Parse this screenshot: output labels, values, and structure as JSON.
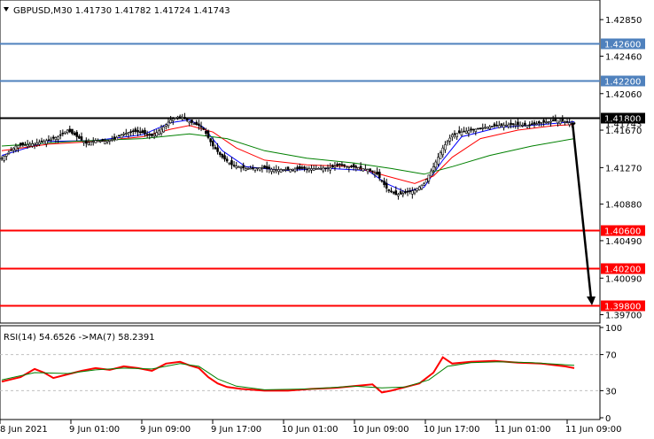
{
  "colors": {
    "background": "#ffffff",
    "candle": "#000000",
    "ma_blue": "#0000ff",
    "ma_red": "#ff0000",
    "ma_green": "#008000",
    "level_blue": "#4f81bd",
    "level_red": "#ff0000",
    "level_black": "#000000",
    "rsi_line": "#ff0000",
    "rsi_ma": "#008000"
  },
  "main_header": {
    "arrow_icon": "triangle-down-icon",
    "text": "GBPUSD,M30  1.41730 1.41782 1.41724 1.41743"
  },
  "rsi_header": {
    "text": "RSI(14) 54.6526  ->MA(7) 58.2391"
  },
  "chart_data": [
    {
      "type": "candlestick",
      "symbol": "GBPUSD",
      "timeframe": "M30",
      "ohlc": {
        "open": 1.4173,
        "high": 1.41782,
        "low": 1.41724,
        "close": 1.41743
      },
      "ylim": [
        1.3962,
        1.4305
      ],
      "y_ticks": [
        "1.42850",
        "1.42460",
        "1.42060",
        "1.41670",
        "1.41270",
        "1.40880",
        "1.40490",
        "1.40090",
        "1.39700"
      ],
      "x_ticks": [
        "8 Jun 2021",
        "9 Jun 01:00",
        "9 Jun 09:00",
        "9 Jun 17:00",
        "10 Jun 01:00",
        "10 Jun 09:00",
        "10 Jun 17:00",
        "11 Jun 01:00",
        "11 Jun 09:00"
      ],
      "current_price": "1.41743",
      "levels": [
        {
          "price": 1.426,
          "label": "1.42600",
          "color": "blue"
        },
        {
          "price": 1.422,
          "label": "1.42200",
          "color": "blue"
        },
        {
          "price": 1.418,
          "label": "1.41800",
          "color": "black"
        },
        {
          "price": 1.406,
          "label": "1.40600",
          "color": "red"
        },
        {
          "price": 1.402,
          "label": "1.40200",
          "color": "red"
        },
        {
          "price": 1.398,
          "label": "1.39800",
          "color": "red"
        }
      ],
      "arrow": {
        "from_price": 1.4175,
        "to_price": 1.398
      },
      "price_path": [
        [
          0,
          1.4137
        ],
        [
          6,
          1.415
        ],
        [
          12,
          1.4152
        ],
        [
          18,
          1.4155
        ],
        [
          24,
          1.416
        ],
        [
          28,
          1.4167
        ],
        [
          32,
          1.416
        ],
        [
          36,
          1.4153
        ],
        [
          40,
          1.4156
        ],
        [
          44,
          1.4155
        ],
        [
          48,
          1.4158
        ],
        [
          52,
          1.4163
        ],
        [
          56,
          1.4166
        ],
        [
          60,
          1.4164
        ],
        [
          64,
          1.4161
        ],
        [
          68,
          1.4168
        ],
        [
          72,
          1.4178
        ],
        [
          76,
          1.4182
        ],
        [
          80,
          1.4176
        ],
        [
          84,
          1.4172
        ],
        [
          86,
          1.4168
        ],
        [
          90,
          1.415
        ],
        [
          94,
          1.4138
        ],
        [
          98,
          1.413
        ],
        [
          104,
          1.4126
        ],
        [
          110,
          1.4127
        ],
        [
          116,
          1.4125
        ],
        [
          122,
          1.4125
        ],
        [
          128,
          1.4126
        ],
        [
          134,
          1.4126
        ],
        [
          140,
          1.4127
        ],
        [
          144,
          1.413
        ],
        [
          148,
          1.4128
        ],
        [
          152,
          1.4127
        ],
        [
          156,
          1.4125
        ],
        [
          160,
          1.412
        ],
        [
          164,
          1.4105
        ],
        [
          168,
          1.4098
        ],
        [
          172,
          1.41
        ],
        [
          176,
          1.4103
        ],
        [
          180,
          1.411
        ],
        [
          184,
          1.4128
        ],
        [
          188,
          1.4148
        ],
        [
          192,
          1.4162
        ],
        [
          196,
          1.4165
        ],
        [
          200,
          1.4167
        ],
        [
          206,
          1.417
        ],
        [
          212,
          1.4172
        ],
        [
          218,
          1.4173
        ],
        [
          224,
          1.4172
        ],
        [
          230,
          1.4175
        ],
        [
          236,
          1.4177
        ],
        [
          240,
          1.4176
        ],
        [
          244,
          1.4174
        ]
      ],
      "series": [
        {
          "color": "blue",
          "values": [
            [
              0,
              1.414
            ],
            [
              20,
              1.4155
            ],
            [
              40,
              1.4156
            ],
            [
              60,
              1.4162
            ],
            [
              72,
              1.4175
            ],
            [
              80,
              1.4178
            ],
            [
              86,
              1.417
            ],
            [
              94,
              1.4145
            ],
            [
              104,
              1.4128
            ],
            [
              120,
              1.4124
            ],
            [
              140,
              1.4126
            ],
            [
              156,
              1.4124
            ],
            [
              164,
              1.411
            ],
            [
              172,
              1.4101
            ],
            [
              180,
              1.4106
            ],
            [
              188,
              1.4135
            ],
            [
              196,
              1.416
            ],
            [
              212,
              1.417
            ],
            [
              230,
              1.4173
            ],
            [
              244,
              1.4176
            ]
          ]
        },
        {
          "color": "red",
          "values": [
            [
              0,
              1.4145
            ],
            [
              20,
              1.4152
            ],
            [
              40,
              1.4155
            ],
            [
              60,
              1.416
            ],
            [
              72,
              1.4168
            ],
            [
              80,
              1.4172
            ],
            [
              90,
              1.4165
            ],
            [
              100,
              1.4148
            ],
            [
              112,
              1.4135
            ],
            [
              130,
              1.413
            ],
            [
              150,
              1.4128
            ],
            [
              164,
              1.4118
            ],
            [
              176,
              1.411
            ],
            [
              184,
              1.4118
            ],
            [
              192,
              1.4138
            ],
            [
              204,
              1.4158
            ],
            [
              220,
              1.4167
            ],
            [
              236,
              1.4172
            ],
            [
              244,
              1.4173
            ]
          ]
        },
        {
          "color": "green",
          "values": [
            [
              0,
              1.415
            ],
            [
              30,
              1.4155
            ],
            [
              60,
              1.4158
            ],
            [
              80,
              1.4163
            ],
            [
              96,
              1.4158
            ],
            [
              112,
              1.4145
            ],
            [
              130,
              1.4137
            ],
            [
              150,
              1.4132
            ],
            [
              166,
              1.4126
            ],
            [
              180,
              1.412
            ],
            [
              192,
              1.4128
            ],
            [
              208,
              1.414
            ],
            [
              226,
              1.415
            ],
            [
              244,
              1.4158
            ]
          ]
        }
      ]
    },
    {
      "type": "line",
      "title": "RSI(14) 54.6526  ->MA(7) 58.2391",
      "ylim": [
        0,
        100
      ],
      "y_ticks": [
        "100",
        "70",
        "30",
        "0"
      ],
      "reference_lines": [
        70,
        30
      ],
      "series": [
        {
          "name": "RSI(14)",
          "color": "red",
          "values": [
            [
              0,
              40
            ],
            [
              8,
              45
            ],
            [
              14,
              54
            ],
            [
              18,
              50
            ],
            [
              22,
              44
            ],
            [
              28,
              48
            ],
            [
              34,
              52
            ],
            [
              40,
              55
            ],
            [
              46,
              53
            ],
            [
              52,
              57
            ],
            [
              58,
              55
            ],
            [
              64,
              52
            ],
            [
              70,
              60
            ],
            [
              76,
              62
            ],
            [
              80,
              58
            ],
            [
              84,
              55
            ],
            [
              88,
              45
            ],
            [
              92,
              38
            ],
            [
              96,
              34
            ],
            [
              102,
              32
            ],
            [
              112,
              30
            ],
            [
              122,
              30
            ],
            [
              132,
              32
            ],
            [
              142,
              33
            ],
            [
              150,
              35
            ],
            [
              158,
              37
            ],
            [
              162,
              28
            ],
            [
              166,
              30
            ],
            [
              172,
              34
            ],
            [
              178,
              38
            ],
            [
              184,
              50
            ],
            [
              188,
              67
            ],
            [
              192,
              60
            ],
            [
              200,
              62
            ],
            [
              210,
              63
            ],
            [
              220,
              61
            ],
            [
              230,
              60
            ],
            [
              240,
              57
            ],
            [
              244,
              55
            ]
          ]
        },
        {
          "name": "MA(7)",
          "color": "green",
          "values": [
            [
              0,
              42
            ],
            [
              14,
              50
            ],
            [
              28,
              49
            ],
            [
              40,
              53
            ],
            [
              52,
              55
            ],
            [
              64,
              54
            ],
            [
              76,
              60
            ],
            [
              84,
              57
            ],
            [
              92,
              43
            ],
            [
              100,
              35
            ],
            [
              112,
              31
            ],
            [
              132,
              32
            ],
            [
              150,
              35
            ],
            [
              162,
              33
            ],
            [
              172,
              34
            ],
            [
              182,
              42
            ],
            [
              190,
              57
            ],
            [
              200,
              61
            ],
            [
              212,
              62
            ],
            [
              226,
              61
            ],
            [
              238,
              59
            ],
            [
              244,
              58
            ]
          ]
        }
      ]
    }
  ]
}
